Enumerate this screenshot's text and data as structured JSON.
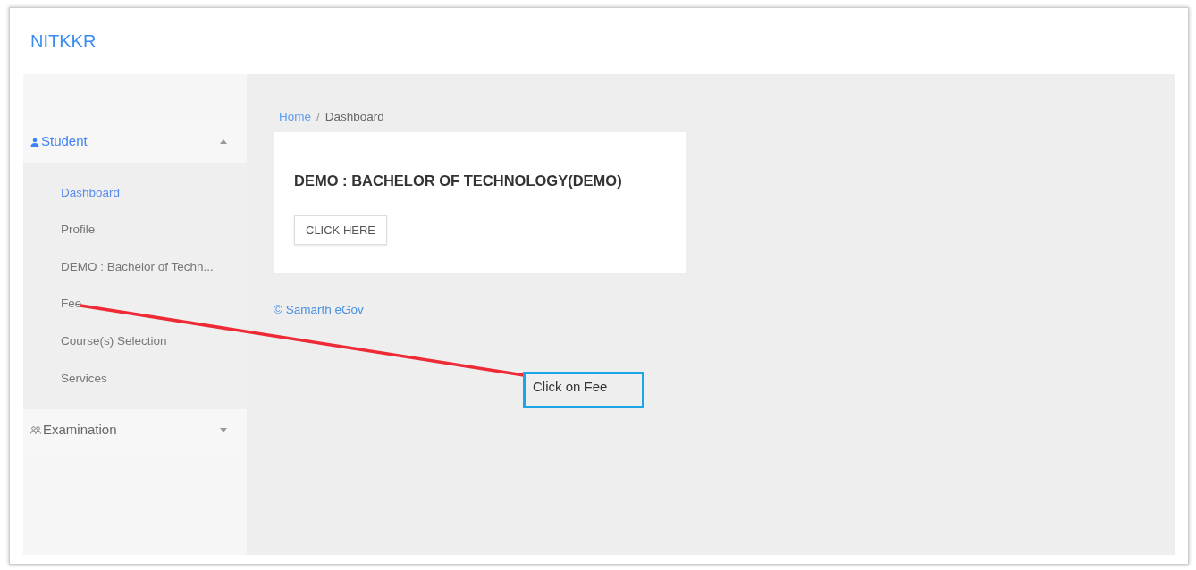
{
  "brand": "NITKKR",
  "sidebar": {
    "sections": [
      {
        "label": "Student",
        "kind": "person",
        "expanded": true,
        "items": [
          {
            "label": "Dashboard",
            "selected": true
          },
          {
            "label": "Profile",
            "selected": false
          },
          {
            "label": "DEMO : Bachelor of Techn...",
            "selected": false
          },
          {
            "label": "Fee",
            "selected": false
          },
          {
            "label": "Course(s) Selection",
            "selected": false
          },
          {
            "label": "Services",
            "selected": false
          }
        ]
      },
      {
        "label": "Examination",
        "kind": "people",
        "expanded": false
      }
    ]
  },
  "breadcrumb": [
    {
      "label": "Home",
      "kind": "link"
    },
    {
      "label": "/",
      "kind": "separator"
    },
    {
      "label": "Dashboard",
      "kind": "current"
    }
  ],
  "card": {
    "title": "DEMO : BACHELOR OF TECHNOLOGY(DEMO)",
    "button": "CLICK HERE"
  },
  "footer": "© Samarth eGov",
  "annotation": {
    "text": "Click on Fee"
  }
}
